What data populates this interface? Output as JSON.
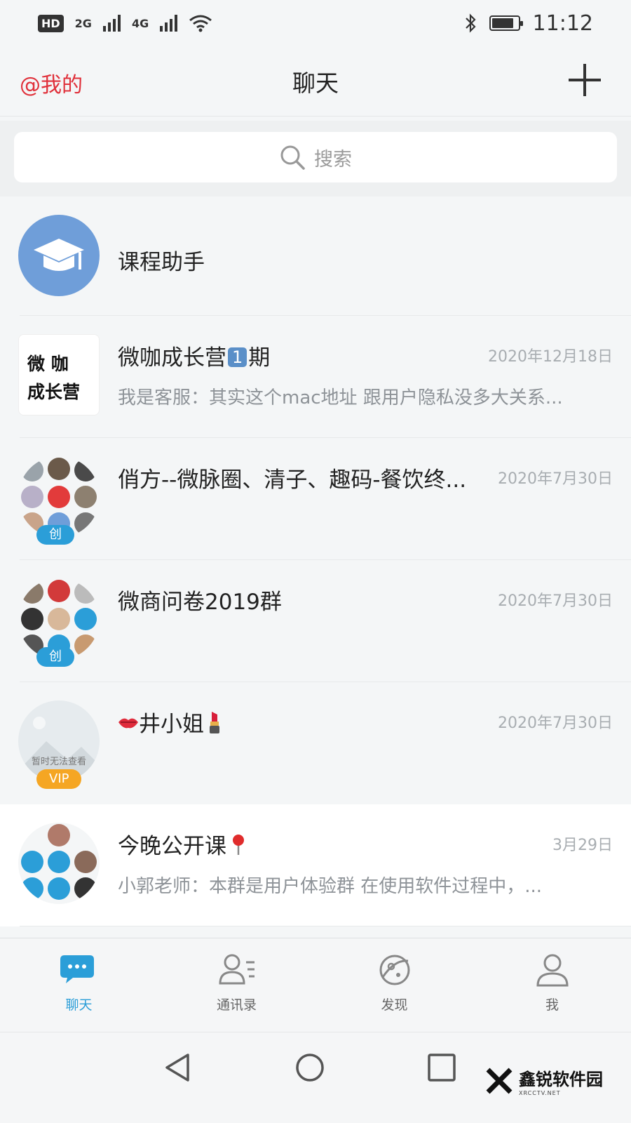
{
  "status_bar": {
    "hd_label": "HD",
    "network_1": "2G",
    "network_2": "4G",
    "time": "11:12",
    "battery_level": 0.85
  },
  "header": {
    "left_label": "@我的",
    "title": "聊天"
  },
  "search": {
    "placeholder": "搜索"
  },
  "chats": [
    {
      "name": "课程助手",
      "date": "",
      "preview": "",
      "avatar_icon": "graduation-cap-icon",
      "avatar_color": "#6f9ed9"
    },
    {
      "name_before": "微咖成长营",
      "name_number": "1",
      "name_after": "期",
      "date": "2020年12月18日",
      "preview": "我是客服：其实这个mac地址 跟用户隐私没多大关系...",
      "avatar_text_1": "微 咖",
      "avatar_text_2": "成长营"
    },
    {
      "name": "俏方--微脉圈、清子、趣码-餐饮终...",
      "date": "2020年7月30日",
      "preview": "",
      "badge": "创"
    },
    {
      "name": "微商问卷2019群",
      "date": "2020年7月30日",
      "preview": "",
      "badge": "创"
    },
    {
      "name": "井小姐",
      "date": "2020年7月30日",
      "preview": "",
      "badge": "VIP",
      "avatar_caption": "暂时无法查看"
    },
    {
      "name": "今晚公开课",
      "date": "3月29日",
      "preview": "小郭老师：本群是用户体验群 在使用软件过程中，..."
    }
  ],
  "tabs": [
    {
      "label": "聊天",
      "icon": "chat-bubble-icon",
      "active": true
    },
    {
      "label": "通讯录",
      "icon": "contacts-icon",
      "active": false
    },
    {
      "label": "发现",
      "icon": "discover-icon",
      "active": false
    },
    {
      "label": "我",
      "icon": "profile-icon",
      "active": false
    }
  ],
  "watermark": {
    "text": "鑫锐软件园",
    "subtext": "XRCCTV.NET"
  },
  "colors": {
    "accent": "#2b9ed8",
    "header_left": "#e0303a",
    "badge_vip": "#f5a623"
  }
}
